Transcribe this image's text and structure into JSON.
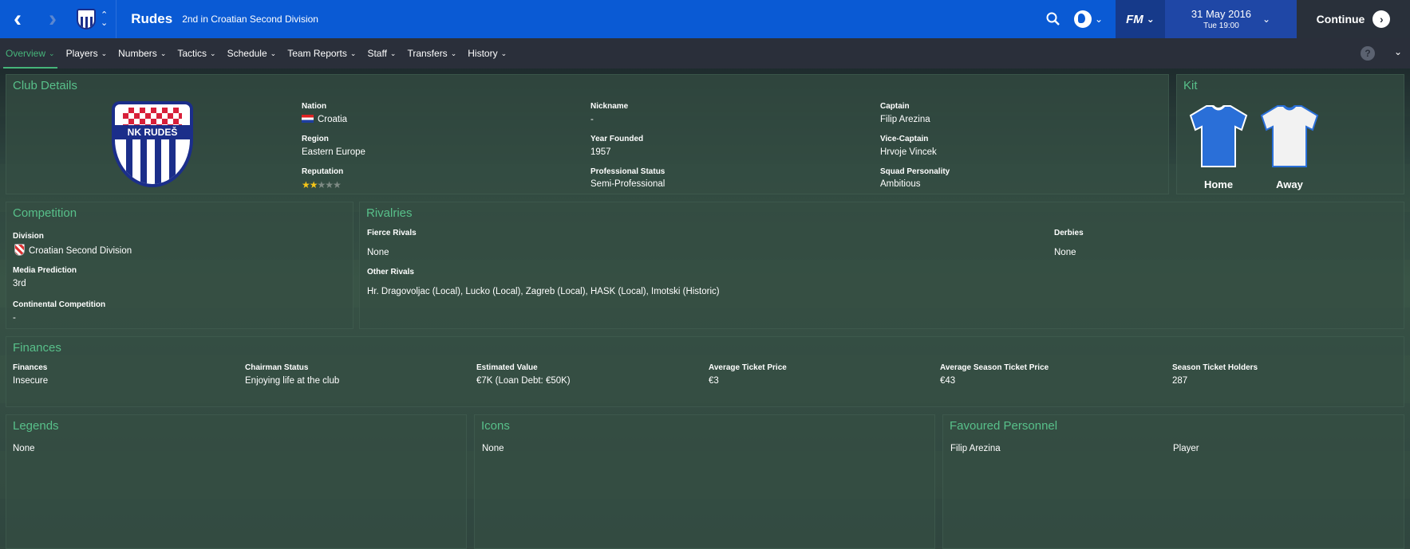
{
  "topbar": {
    "back_icon": "chevron-left-icon",
    "forward_icon": "chevron-right-icon",
    "club_name": "Rudes",
    "club_subtitle": "2nd in Croatian Second Division",
    "search_icon": "search-icon",
    "globe_icon": "globe-icon",
    "fm_label": "FM",
    "date": "31 May 2016",
    "time": "Tue 19:00",
    "continue_label": "Continue"
  },
  "nav": {
    "items": [
      {
        "label": "Overview"
      },
      {
        "label": "Players"
      },
      {
        "label": "Numbers"
      },
      {
        "label": "Tactics"
      },
      {
        "label": "Schedule"
      },
      {
        "label": "Team Reports"
      },
      {
        "label": "Staff"
      },
      {
        "label": "Transfers"
      },
      {
        "label": "History"
      }
    ],
    "active": "Overview",
    "help_label": "?"
  },
  "club_details": {
    "title": "Club Details",
    "crest_text": "NK RUDEŠ",
    "nation_label": "Nation",
    "nation": "Croatia",
    "region_label": "Region",
    "region": "Eastern Europe",
    "reputation_label": "Reputation",
    "reputation_stars": 2,
    "reputation_max": 5,
    "nickname_label": "Nickname",
    "nickname": "-",
    "year_founded_label": "Year Founded",
    "year_founded": "1957",
    "professional_status_label": "Professional Status",
    "professional_status": "Semi-Professional",
    "captain_label": "Captain",
    "captain": "Filip Arezina",
    "vice_captain_label": "Vice-Captain",
    "vice_captain": "Hrvoje Vincek",
    "squad_personality_label": "Squad Personality",
    "squad_personality": "Ambitious"
  },
  "kit": {
    "title": "Kit",
    "home_label": "Home",
    "away_label": "Away",
    "home_color": "#2a6fd8",
    "away_color": "#f2f2f2"
  },
  "competition": {
    "title": "Competition",
    "division_label": "Division",
    "division": "Croatian Second Division",
    "media_prediction_label": "Media Prediction",
    "media_prediction": "3rd",
    "continental_label": "Continental Competition",
    "continental": "-"
  },
  "rivalries": {
    "title": "Rivalries",
    "fierce_label": "Fierce Rivals",
    "fierce": "None",
    "derbies_label": "Derbies",
    "derbies": "None",
    "other_label": "Other Rivals",
    "other": "Hr. Dragovoljac (Local), Lucko (Local), Zagreb (Local), HASK (Local), Imotski (Historic)"
  },
  "finances": {
    "title": "Finances",
    "columns": [
      {
        "label": "Finances",
        "value": "Insecure"
      },
      {
        "label": "Chairman Status",
        "value": "Enjoying life at the club"
      },
      {
        "label": "Estimated Value",
        "value": "€7K (Loan Debt: €50K)"
      },
      {
        "label": "Average Ticket Price",
        "value": "€3"
      },
      {
        "label": "Average Season Ticket Price",
        "value": "€43"
      },
      {
        "label": "Season Ticket Holders",
        "value": "287"
      }
    ]
  },
  "legends": {
    "title": "Legends",
    "value": "None"
  },
  "icons": {
    "title": "Icons",
    "value": "None"
  },
  "favoured": {
    "title": "Favoured Personnel",
    "rows": [
      {
        "name": "Filip Arezina",
        "role": "Player"
      }
    ]
  },
  "colors": {
    "topbar": "#0a5ad4",
    "accent_green": "#58c08a",
    "navbar": "#2a2f3a"
  }
}
